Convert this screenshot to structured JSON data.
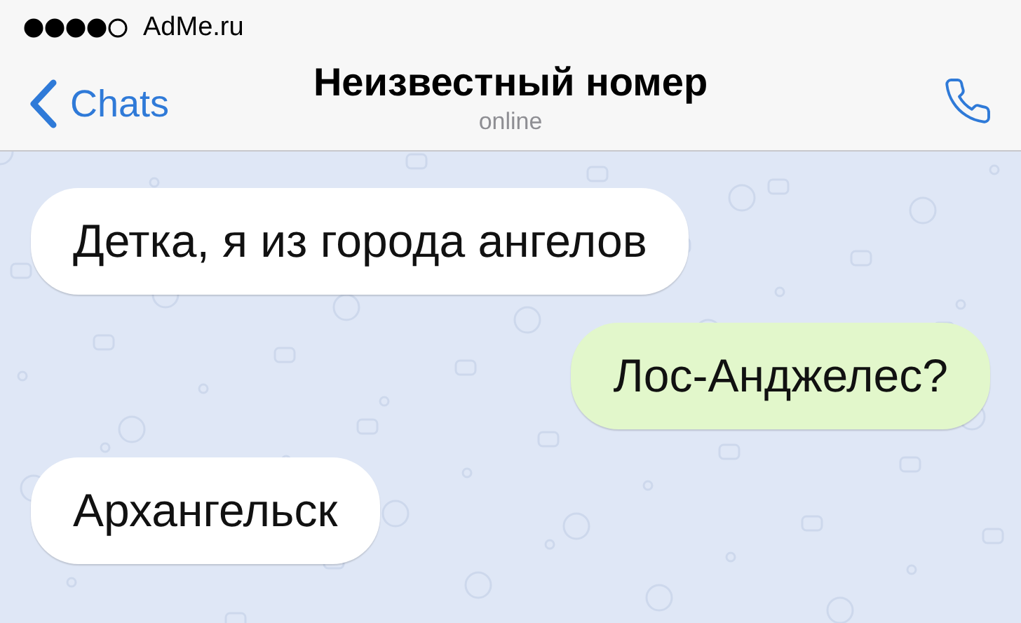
{
  "status_bar": {
    "carrier": "AdMe.ru"
  },
  "nav_bar": {
    "back": "Chats",
    "title": "Неизвестный номер",
    "subtitle": "online"
  },
  "messages": [
    {
      "kind": "incoming",
      "text": "Детка, я из города ангелов"
    },
    {
      "kind": "outgoing",
      "text": "Лос-Анджелес?"
    },
    {
      "kind": "incoming",
      "text": "Архангельск"
    }
  ]
}
